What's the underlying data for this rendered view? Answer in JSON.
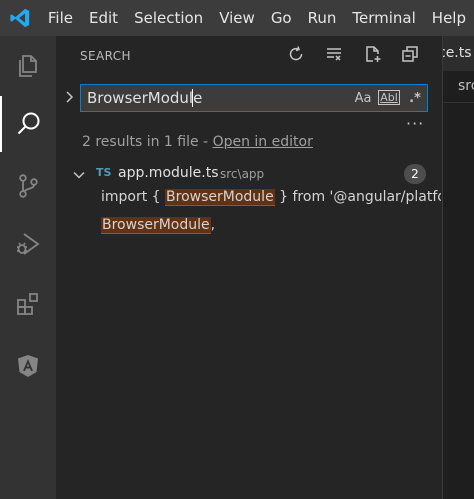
{
  "menubar": {
    "items": [
      "File",
      "Edit",
      "Selection",
      "View",
      "Go",
      "Run",
      "Terminal",
      "Help"
    ]
  },
  "activity_bar": {
    "items": [
      {
        "icon": "files-icon",
        "active": false
      },
      {
        "icon": "search-icon",
        "active": true
      },
      {
        "icon": "source-control-icon",
        "active": false
      },
      {
        "icon": "run-debug-icon",
        "active": false
      },
      {
        "icon": "extensions-icon",
        "active": false
      },
      {
        "icon": "angular-icon",
        "active": false
      }
    ]
  },
  "sidebar": {
    "title": "SEARCH",
    "actions": [
      "refresh-icon",
      "clear-results-icon",
      "new-search-editor-icon",
      "collapse-all-icon"
    ]
  },
  "search": {
    "value": "BrowserModule",
    "options": {
      "match_case": "Aa",
      "whole_word": "Abl",
      "regex": ".*"
    },
    "more": "···"
  },
  "results": {
    "summary": "2 results in 1 file - ",
    "open_editor": "Open in editor",
    "file": {
      "badge": "TS",
      "name": "app.module.ts",
      "dir": "src\\app",
      "count": "2"
    },
    "matches": [
      {
        "before": "import { ",
        "match": "BrowserModule",
        "after": " } from '@angular/platfo..."
      },
      {
        "before": "",
        "match": "BrowserModule",
        "after": ","
      }
    ]
  },
  "editor": {
    "tabs": [
      "ce.ts",
      "src"
    ]
  },
  "colors": {
    "accent": "#007fd4",
    "match_bg": "#613214",
    "ts_blue": "#519aba",
    "vscode_blue": "#23a9f2"
  }
}
